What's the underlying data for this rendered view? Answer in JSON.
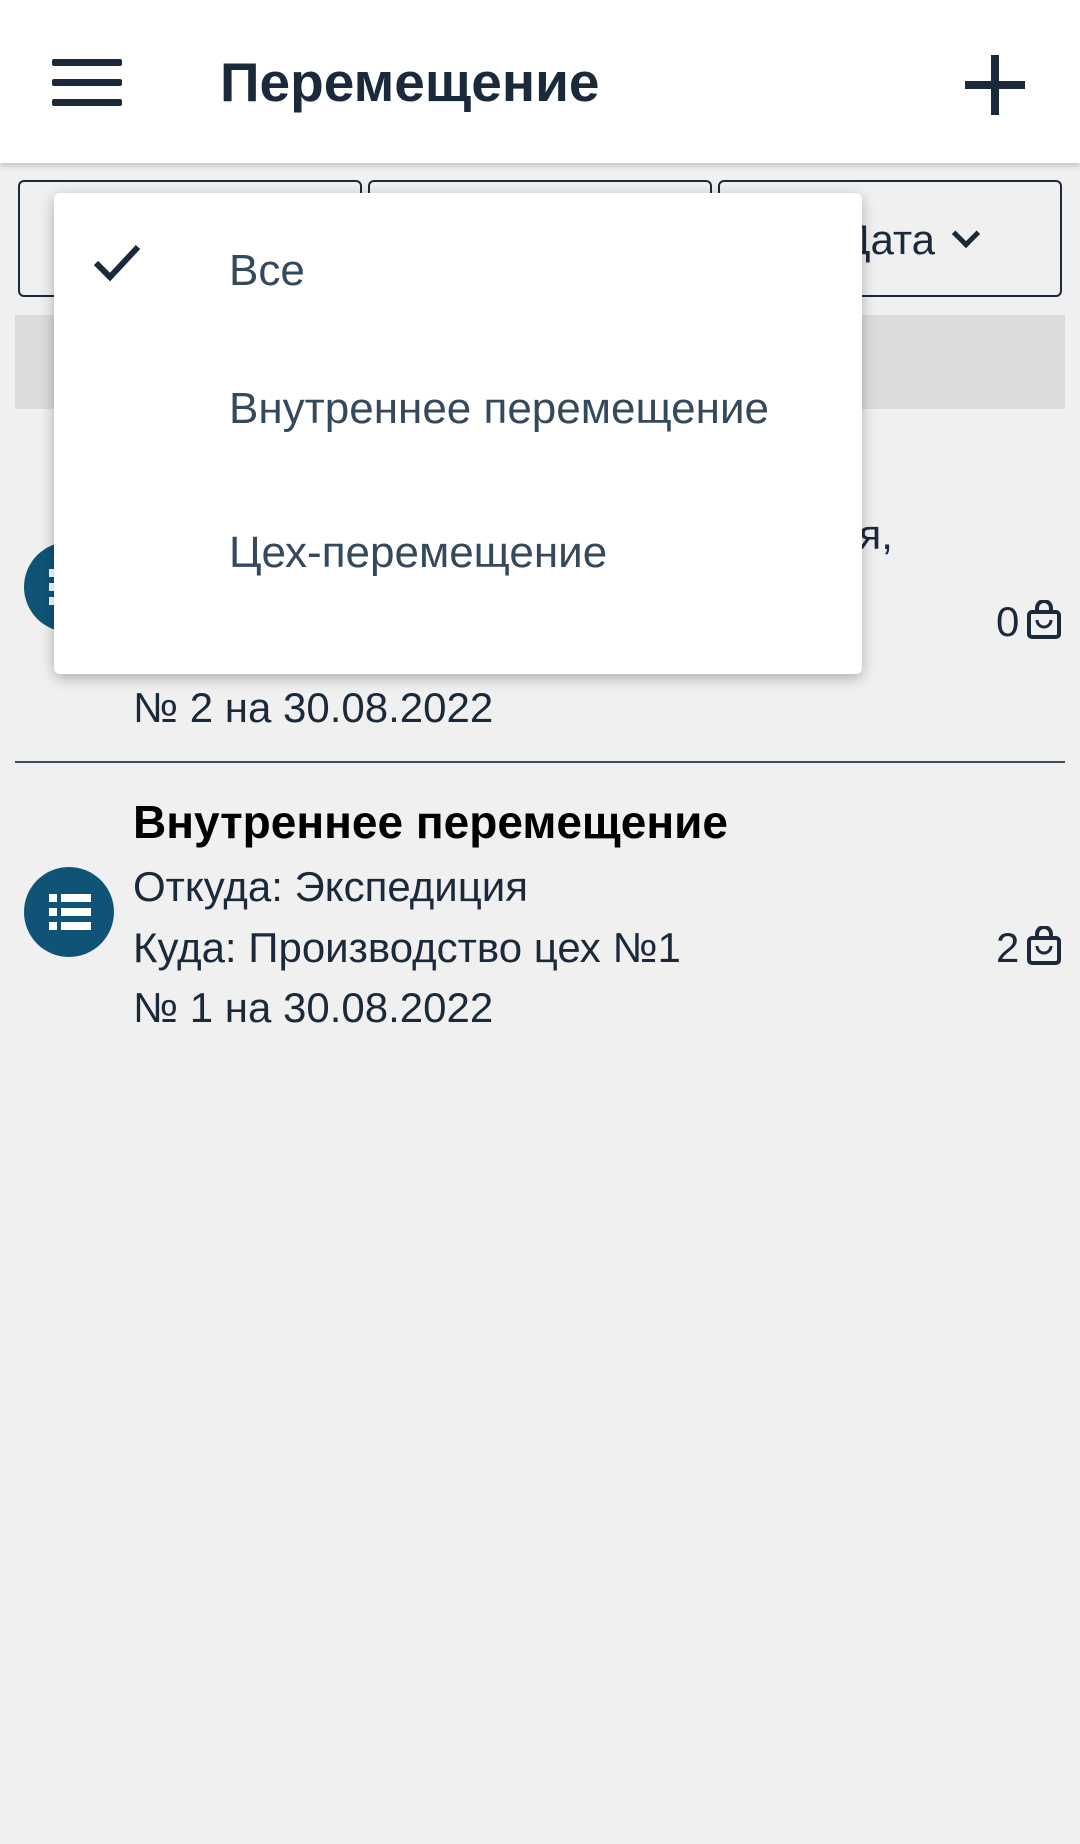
{
  "header": {
    "title": "Перемещение"
  },
  "filters": [
    {
      "label": ""
    },
    {
      "label": ""
    },
    {
      "label": "Дата"
    }
  ],
  "documents": [
    {
      "title": "",
      "from": "",
      "to": "...ия,",
      "number": "№ 2 на 30.08.2022",
      "count": "0"
    },
    {
      "title": "Внутреннее перемещение",
      "from": "Откуда: Экспедиция",
      "to": "Куда: Производство цех №1",
      "number": "№ 1 на 30.08.2022",
      "count": "2"
    }
  ],
  "dropdown": {
    "items": [
      {
        "label": "Все",
        "selected": true
      },
      {
        "label": "Внутреннее перемещение",
        "selected": false
      },
      {
        "label": "Цех-перемещение",
        "selected": false
      }
    ]
  },
  "icons": {
    "menu": "hamburger-menu-icon",
    "add": "plus-icon",
    "document": "list-icon",
    "bag": "shopping-bag-icon",
    "check": "checkmark-icon"
  },
  "colors": {
    "primary_text": "#1b2a3b",
    "accent": "#0f5476",
    "background": "#f0f0f0"
  }
}
